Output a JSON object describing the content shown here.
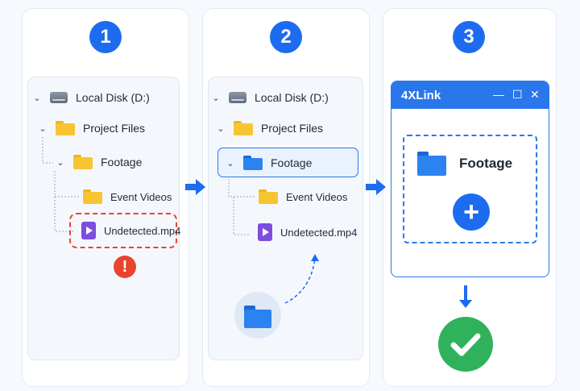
{
  "steps": [
    {
      "number": "1"
    },
    {
      "number": "2"
    },
    {
      "number": "3"
    }
  ],
  "panel1": {
    "disk_label": "Local Disk (D:)",
    "project_label": "Project Files",
    "footage_label": "Footage",
    "event_label": "Event Videos",
    "file_label": "Undetected.mp4",
    "warning_glyph": "!"
  },
  "panel2": {
    "disk_label": "Local Disk (D:)",
    "project_label": "Project Files",
    "footage_label": "Footage",
    "event_label": "Event Videos",
    "file_label": "Undetected.mp4"
  },
  "panel3": {
    "window_title": "4XLink",
    "minimize_glyph": "—",
    "maximize_glyph": "☐",
    "close_glyph": "✕",
    "folder_label": "Footage",
    "add_glyph": "+"
  },
  "colors": {
    "accent": "#1d6cf0",
    "folder_yellow": "#f7c531",
    "folder_blue": "#2c82ef",
    "video_purple": "#7c4dde",
    "warning_red": "#e8442e",
    "success_green": "#2fb25b"
  },
  "icons": [
    "disk-icon",
    "folder-icon",
    "video-file-icon",
    "warning-icon",
    "arrow-right-icon",
    "plus-icon",
    "check-icon",
    "arrow-down-icon"
  ]
}
